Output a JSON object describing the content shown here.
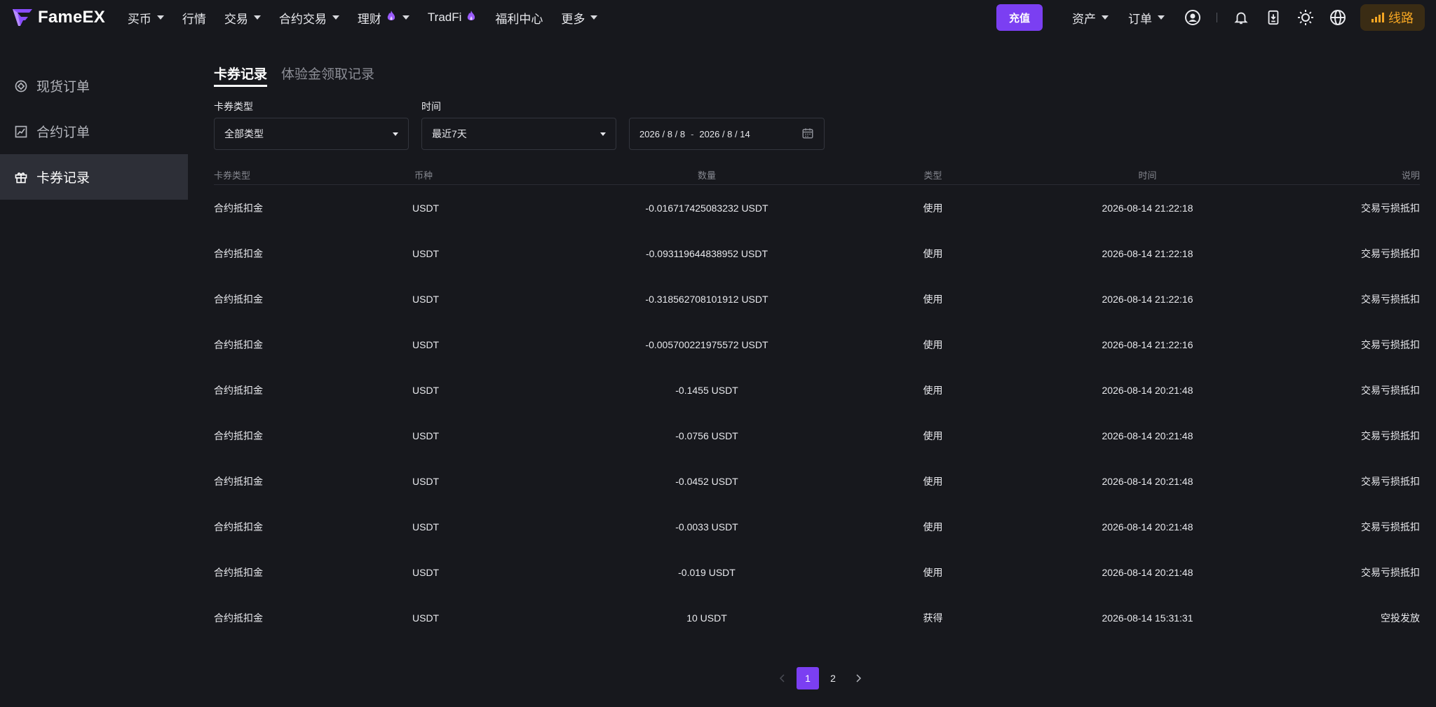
{
  "brand": {
    "name": "FameEX"
  },
  "nav": {
    "items": [
      {
        "label": "买币",
        "dropdown": true
      },
      {
        "label": "行情",
        "dropdown": false
      },
      {
        "label": "交易",
        "dropdown": true
      },
      {
        "label": "合约交易",
        "dropdown": true
      },
      {
        "label": "理财",
        "dropdown": true,
        "fire": true
      },
      {
        "label": "TradFi",
        "dropdown": false,
        "fire": true
      },
      {
        "label": "福利中心",
        "dropdown": false
      },
      {
        "label": "更多",
        "dropdown": true
      }
    ],
    "deposit_label": "充值",
    "assets_label": "资产",
    "orders_label": "订单",
    "route_label": "线路"
  },
  "sidebar": {
    "items": [
      {
        "label": "现货订单",
        "icon": "spot-order-icon",
        "active": false
      },
      {
        "label": "合约订单",
        "icon": "contract-order-icon",
        "active": false
      },
      {
        "label": "卡券记录",
        "icon": "gift-icon",
        "active": true
      }
    ]
  },
  "tabs": [
    {
      "label": "卡券记录",
      "active": true
    },
    {
      "label": "体验金领取记录",
      "active": false
    }
  ],
  "filters": {
    "type_label": "卡券类型",
    "type_value": "全部类型",
    "time_label": "时间",
    "time_value": "最近7天",
    "date_start": "2026 / 8 / 8",
    "date_end": "2026 / 8 / 14"
  },
  "table": {
    "columns": [
      "卡券类型",
      "币种",
      "数量",
      "类型",
      "时间",
      "说明"
    ],
    "rows": [
      [
        "合约抵扣金",
        "USDT",
        "-0.016717425083232 USDT",
        "使用",
        "2026-08-14 21:22:18",
        "交易亏损抵扣"
      ],
      [
        "合约抵扣金",
        "USDT",
        "-0.093119644838952 USDT",
        "使用",
        "2026-08-14 21:22:18",
        "交易亏损抵扣"
      ],
      [
        "合约抵扣金",
        "USDT",
        "-0.318562708101912 USDT",
        "使用",
        "2026-08-14 21:22:16",
        "交易亏损抵扣"
      ],
      [
        "合约抵扣金",
        "USDT",
        "-0.005700221975572 USDT",
        "使用",
        "2026-08-14 21:22:16",
        "交易亏损抵扣"
      ],
      [
        "合约抵扣金",
        "USDT",
        "-0.1455 USDT",
        "使用",
        "2026-08-14 20:21:48",
        "交易亏损抵扣"
      ],
      [
        "合约抵扣金",
        "USDT",
        "-0.0756 USDT",
        "使用",
        "2026-08-14 20:21:48",
        "交易亏损抵扣"
      ],
      [
        "合约抵扣金",
        "USDT",
        "-0.0452 USDT",
        "使用",
        "2026-08-14 20:21:48",
        "交易亏损抵扣"
      ],
      [
        "合约抵扣金",
        "USDT",
        "-0.0033 USDT",
        "使用",
        "2026-08-14 20:21:48",
        "交易亏损抵扣"
      ],
      [
        "合约抵扣金",
        "USDT",
        "-0.019 USDT",
        "使用",
        "2026-08-14 20:21:48",
        "交易亏损抵扣"
      ],
      [
        "合约抵扣金",
        "USDT",
        "10 USDT",
        "获得",
        "2026-08-14 15:31:31",
        "空投发放"
      ]
    ]
  },
  "pagination": {
    "pages": [
      "1",
      "2"
    ],
    "current": "1"
  },
  "colors": {
    "accent": "#7b3ff2",
    "route": "#f5a623",
    "background": "#17181d",
    "sidebar_active": "#2d2f37"
  }
}
